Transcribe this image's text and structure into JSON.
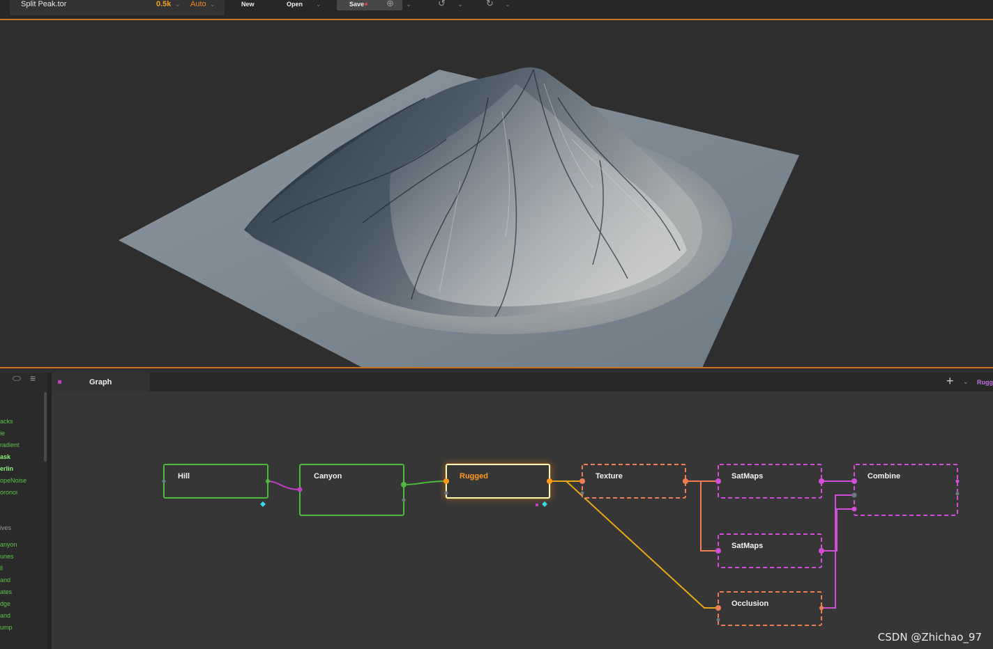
{
  "topbar": {
    "document_title": "Split Peak.tor",
    "resolution": "0.5k",
    "build_mode": "Auto",
    "new_label": "New",
    "open_label": "Open",
    "save_label": "Save",
    "icons": [
      "chevron-down-icon",
      "plus-circle-icon",
      "undo-icon",
      "redo-icon"
    ]
  },
  "library": {
    "items_top": [
      {
        "label": "acks",
        "bright": false
      },
      {
        "label": "ie",
        "bright": false
      },
      {
        "label": "radient",
        "bright": false
      },
      {
        "label": "ask",
        "bright": true
      },
      {
        "label": "erlin",
        "bright": true
      },
      {
        "label": "opeNoise",
        "bright": false
      },
      {
        "label": "oronoi",
        "bright": false
      }
    ],
    "section_header": "ives",
    "items_bottom": [
      "anyon",
      "unes",
      "ll",
      "and",
      "ates",
      "dge",
      "and",
      "ump"
    ]
  },
  "graph_panel": {
    "tab_label": "Graph",
    "active_node_short": "Rugg",
    "nodes": [
      {
        "id": "hill",
        "label": "Hill"
      },
      {
        "id": "canyon",
        "label": "Canyon"
      },
      {
        "id": "rugged",
        "label": "Rugged"
      },
      {
        "id": "texture",
        "label": "Texture"
      },
      {
        "id": "satmaps1",
        "label": "SatMaps"
      },
      {
        "id": "satmaps2",
        "label": "SatMaps"
      },
      {
        "id": "occlusion",
        "label": "Occlusion"
      },
      {
        "id": "combine",
        "label": "Combine"
      }
    ]
  },
  "colors": {
    "accent_orange": "#c8741f",
    "primitive_green": "#4cbb3c",
    "active_orange": "#ff9a1a",
    "texture_salmon": "#ee7f55",
    "satmaps_magenta": "#d24ed8",
    "wire_yellow": "#e6a817"
  },
  "watermark": "CSDN @Zhichao_97"
}
